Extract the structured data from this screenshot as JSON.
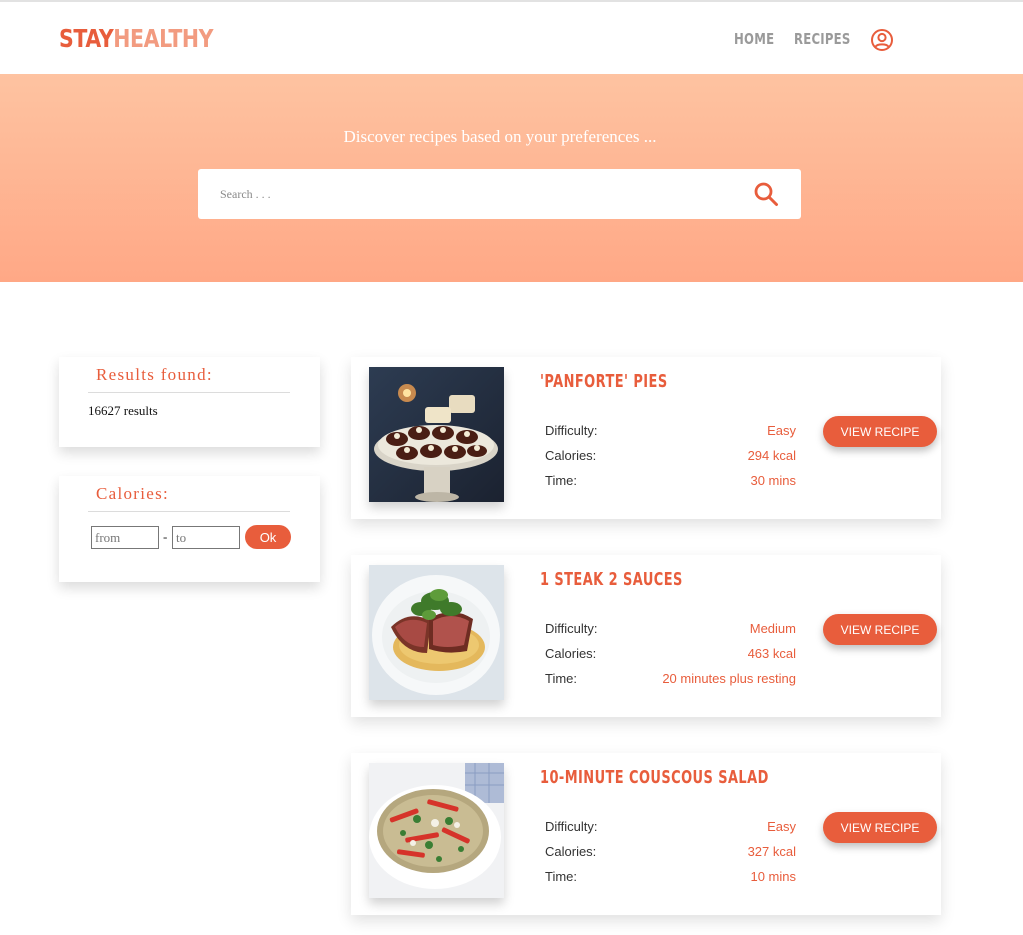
{
  "brand": {
    "part1": "STAY",
    "part2": "HEALTHY"
  },
  "nav": {
    "home": "HOME",
    "recipes": "RECIPES",
    "account_icon": "user-circle-icon"
  },
  "hero": {
    "title": "Discover recipes based on your preferences ...",
    "search_placeholder": "Search . . .",
    "search_value": "",
    "search_icon": "search-icon"
  },
  "sidebar": {
    "results": {
      "title": "Results found:",
      "count": "16627 results"
    },
    "calories": {
      "title": "Calories:",
      "from_placeholder": "from",
      "to_placeholder": "to",
      "dash": "-",
      "ok_label": "Ok"
    }
  },
  "labels": {
    "difficulty": "Difficulty:",
    "calories": "Calories:",
    "time": "Time:",
    "view_button": "VIEW RECIPE"
  },
  "recipes": [
    {
      "title": "'Panforte' pies",
      "difficulty": "Easy",
      "calories": "294 kcal",
      "time": "30 mins"
    },
    {
      "title": "1 steak 2 sauces",
      "difficulty": "Medium",
      "calories": "463 kcal",
      "time": "20 minutes plus resting"
    },
    {
      "title": "10-minute couscous salad",
      "difficulty": "Easy",
      "calories": "327 kcal",
      "time": "10 mins"
    }
  ],
  "colors": {
    "accent": "#e85d3c",
    "accent_light": "#f29b80",
    "hero_top": "#fec3a1",
    "hero_bottom": "#ffa886"
  }
}
